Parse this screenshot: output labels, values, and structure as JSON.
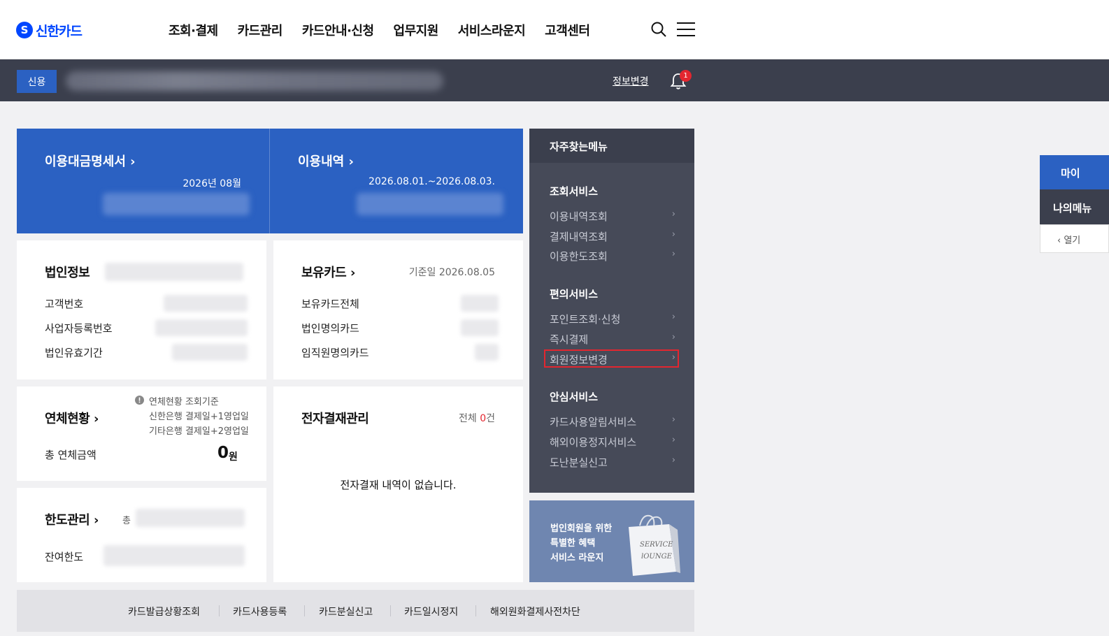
{
  "header": {
    "logo_text": "신한카드",
    "logo_mark": "S",
    "nav": [
      "조회·결제",
      "카드관리",
      "카드안내·신청",
      "업무지원",
      "서비스라운지",
      "고객센터"
    ],
    "search_icon": "search-icon",
    "menu_icon": "hamburger-menu-icon"
  },
  "userbar": {
    "badge": "신용",
    "info_change": "정보변경",
    "notification_count": "1"
  },
  "summary": {
    "statement_title": "이용대금명세서 ›",
    "statement_month": "2026년 08월",
    "usage_title": "이용내역 ›",
    "usage_period": "2026.08.01.~2026.08.03."
  },
  "corp_info": {
    "title": "법인정보",
    "rows": [
      "고객번호",
      "사업자등록번호",
      "법인유효기간"
    ]
  },
  "owned_cards": {
    "title": "보유카드 ›",
    "base_date": "기준일 2026.08.05",
    "rows": [
      "보유카드전체",
      "법인명의카드",
      "임직원명의카드"
    ]
  },
  "overdue": {
    "title": "연체현황 ›",
    "notice_line1": "연체현황 조회기준",
    "notice_line2": "신한은행 결제일+1영업일",
    "notice_line3": "기타은행 결제일+2영업일",
    "total_label": "총 연체금액",
    "total_amount": "0",
    "total_unit": "원"
  },
  "epayment": {
    "title": "전자결재관리",
    "count_prefix": "전체 ",
    "count": "0",
    "count_suffix": "건",
    "empty_message": "전자결재 내역이 없습니다."
  },
  "limit": {
    "title": "한도관리 ›",
    "total_label": "총",
    "remaining_label": "잔여한도"
  },
  "frequent_menu": {
    "title": "자주찾는메뉴",
    "sections": [
      {
        "title": "조회서비스",
        "items": [
          "이용내역조회",
          "결제내역조회",
          "이용한도조회"
        ]
      },
      {
        "title": "편의서비스",
        "items": [
          "포인트조회·신청",
          "즉시결제",
          "회원정보변경"
        ]
      },
      {
        "title": "안심서비스",
        "items": [
          "카드사용알림서비스",
          "해외이용정지서비스",
          "도난분실신고"
        ]
      }
    ],
    "chevron": "›"
  },
  "promo": {
    "line1": "법인회원을 위한",
    "line2": "특별한 혜택",
    "line3": "서비스 라운지",
    "bag_line1": "SERVICE",
    "bag_line2": "lOUNGE"
  },
  "bottom_links": [
    "카드발급상황조회",
    "카드사용등록",
    "카드분실신고",
    "카드일시정지",
    "해외원화결제사전차단"
  ],
  "side_menu": {
    "my": "마이",
    "my_menu": "나의메뉴",
    "open": "‹ 열기"
  }
}
